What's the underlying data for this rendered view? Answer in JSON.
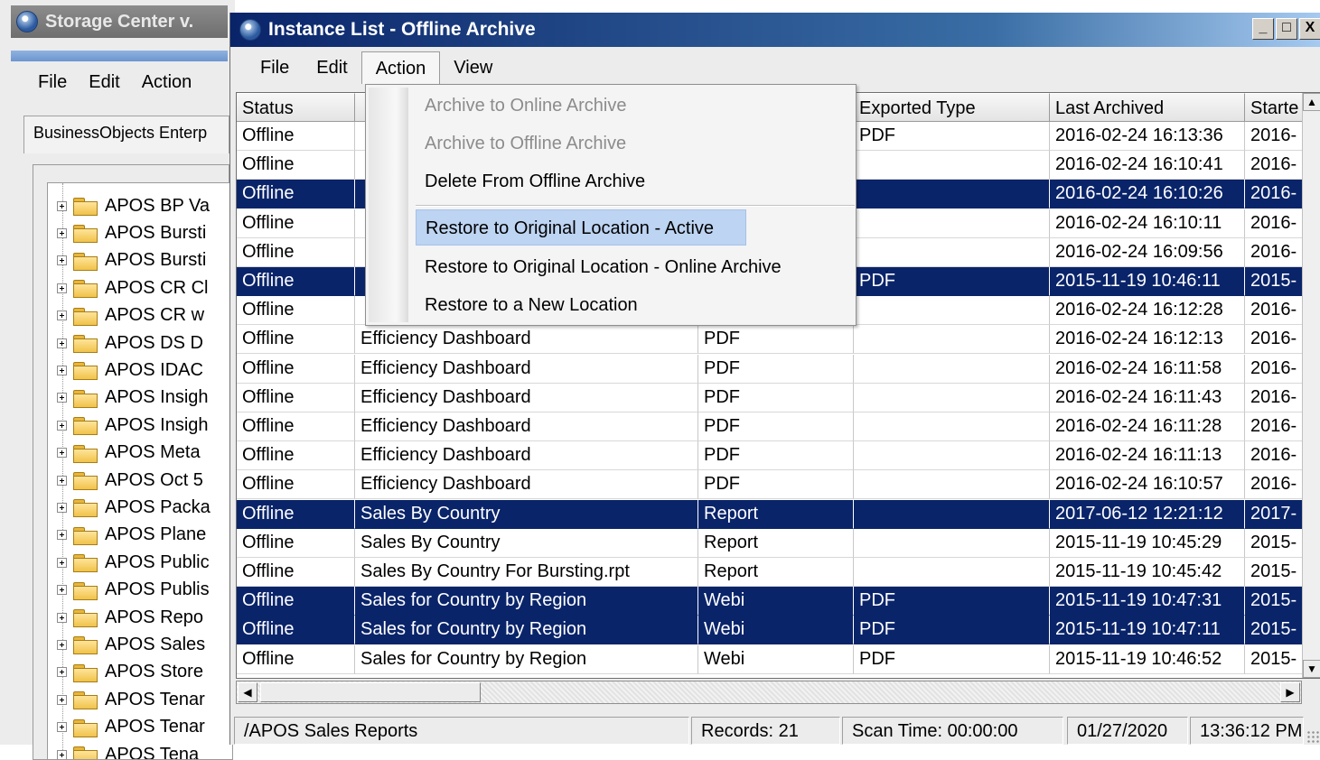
{
  "bg_window": {
    "title": "Storage Center v.",
    "menu": [
      "File",
      "Edit",
      "Action"
    ],
    "tab_label": "BusinessObjects Enterp",
    "tree_items": [
      "APOS BP Va",
      "APOS Bursti",
      "APOS Bursti",
      "APOS CR Cl",
      "APOS CR w",
      "APOS DS D",
      "APOS IDAC",
      "APOS Insigh",
      "APOS Insigh",
      "APOS Meta",
      "APOS Oct 5",
      "APOS Packa",
      "APOS Plane",
      "APOS Public",
      "APOS Publis",
      "APOS Repo",
      "APOS Sales",
      "APOS Store",
      "APOS Tenar",
      "APOS Tenar",
      "APOS Tena"
    ]
  },
  "window": {
    "title": "Instance List - Offline Archive",
    "controls": {
      "minimize": "_",
      "maximize": "□",
      "close": "X"
    }
  },
  "menubar": [
    "File",
    "Edit",
    "Action",
    "View"
  ],
  "active_menu": "Action",
  "columns": [
    "Status",
    "",
    "",
    "Exported Type",
    "Last Archived",
    "Starte"
  ],
  "rows": [
    {
      "status": "Offline",
      "name": "",
      "type": "",
      "exported": "PDF",
      "archived": "2016-02-24 16:13:36",
      "started": "2016-",
      "selected": false
    },
    {
      "status": "Offline",
      "name": "",
      "type": "",
      "exported": "",
      "archived": "2016-02-24 16:10:41",
      "started": "2016-",
      "selected": false
    },
    {
      "status": "Offline",
      "name": "",
      "type": "",
      "exported": "",
      "archived": "2016-02-24 16:10:26",
      "started": "2016-",
      "selected": true
    },
    {
      "status": "Offline",
      "name": "",
      "type": "",
      "exported": "",
      "archived": "2016-02-24 16:10:11",
      "started": "2016-",
      "selected": false
    },
    {
      "status": "Offline",
      "name": "",
      "type": "",
      "exported": "",
      "archived": "2016-02-24 16:09:56",
      "started": "2016-",
      "selected": false
    },
    {
      "status": "Offline",
      "name": "",
      "type": "",
      "exported": "PDF",
      "archived": "2015-11-19 10:46:11",
      "started": "2015-",
      "selected": true
    },
    {
      "status": "Offline",
      "name": "",
      "type": "",
      "exported": "",
      "archived": "2016-02-24 16:12:28",
      "started": "2016-",
      "selected": false
    },
    {
      "status": "Offline",
      "name": "Efficiency Dashboard",
      "type": "PDF",
      "exported": "",
      "archived": "2016-02-24 16:12:13",
      "started": "2016-",
      "selected": false
    },
    {
      "status": "Offline",
      "name": "Efficiency Dashboard",
      "type": "PDF",
      "exported": "",
      "archived": "2016-02-24 16:11:58",
      "started": "2016-",
      "selected": false
    },
    {
      "status": "Offline",
      "name": "Efficiency Dashboard",
      "type": "PDF",
      "exported": "",
      "archived": "2016-02-24 16:11:43",
      "started": "2016-",
      "selected": false
    },
    {
      "status": "Offline",
      "name": "Efficiency Dashboard",
      "type": "PDF",
      "exported": "",
      "archived": "2016-02-24 16:11:28",
      "started": "2016-",
      "selected": false
    },
    {
      "status": "Offline",
      "name": "Efficiency Dashboard",
      "type": "PDF",
      "exported": "",
      "archived": "2016-02-24 16:11:13",
      "started": "2016-",
      "selected": false
    },
    {
      "status": "Offline",
      "name": "Efficiency Dashboard",
      "type": "PDF",
      "exported": "",
      "archived": "2016-02-24 16:10:57",
      "started": "2016-",
      "selected": false
    },
    {
      "status": "Offline",
      "name": "Sales By Country",
      "type": "Report",
      "exported": "",
      "archived": "2017-06-12 12:21:12",
      "started": "2017-",
      "selected": true
    },
    {
      "status": "Offline",
      "name": "Sales By Country",
      "type": "Report",
      "exported": "",
      "archived": "2015-11-19 10:45:29",
      "started": "2015-",
      "selected": false
    },
    {
      "status": "Offline",
      "name": "Sales By Country For Bursting.rpt",
      "type": "Report",
      "exported": "",
      "archived": "2015-11-19 10:45:42",
      "started": "2015-",
      "selected": false
    },
    {
      "status": "Offline",
      "name": "Sales for Country by Region",
      "type": "Webi",
      "exported": "PDF",
      "archived": "2015-11-19 10:47:31",
      "started": "2015-",
      "selected": true
    },
    {
      "status": "Offline",
      "name": "Sales for Country by Region",
      "type": "Webi",
      "exported": "PDF",
      "archived": "2015-11-19 10:47:11",
      "started": "2015-",
      "selected": true
    },
    {
      "status": "Offline",
      "name": "Sales for Country by Region",
      "type": "Webi",
      "exported": "PDF",
      "archived": "2015-11-19 10:46:52",
      "started": "2015-",
      "selected": false
    }
  ],
  "action_menu": {
    "items": [
      {
        "label": "Archive to Online Archive",
        "disabled": true,
        "highlight": false
      },
      {
        "label": "Archive to Offline Archive",
        "disabled": true,
        "highlight": false
      },
      {
        "label": "Delete From Offline Archive",
        "disabled": false,
        "highlight": false
      },
      {
        "label": "Restore to Original Location - Active",
        "disabled": false,
        "highlight": true
      },
      {
        "label": "Restore to Original Location - Online Archive",
        "disabled": false,
        "highlight": false
      },
      {
        "label": "Restore to a New Location",
        "disabled": false,
        "highlight": false
      }
    ]
  },
  "statusbar": {
    "path": "/APOS Sales Reports",
    "records": "Records: 21",
    "scan_time": "Scan Time: 00:00:00",
    "date": "01/27/2020",
    "time": "13:36:12 PM"
  },
  "colors": {
    "selection": "#0a246a",
    "menu_highlight": "#bdd4f2",
    "title_gradient_start": "#0a246a",
    "title_gradient_end": "#a6caf0"
  },
  "icons": [
    "app-globe-icon",
    "folder-icon",
    "expand-plus-icon",
    "scroll-up-arrow-icon",
    "scroll-down-arrow-icon",
    "scroll-left-arrow-icon",
    "scroll-right-arrow-icon",
    "resize-grip-icon"
  ]
}
